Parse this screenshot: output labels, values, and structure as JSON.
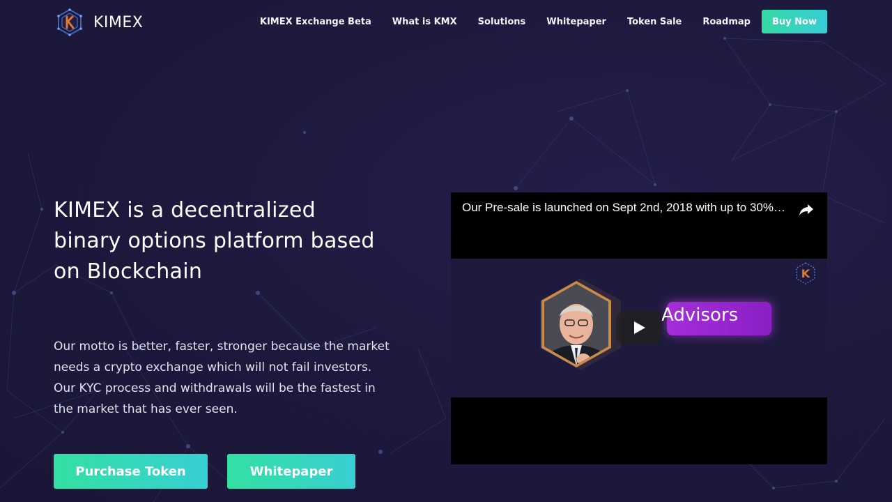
{
  "header": {
    "brand": "KIMEX",
    "nav": [
      {
        "label": "KIMEX Exchange Beta"
      },
      {
        "label": "What is KMX"
      },
      {
        "label": "Solutions"
      },
      {
        "label": "Whitepaper"
      },
      {
        "label": "Token Sale"
      },
      {
        "label": "Roadmap"
      }
    ],
    "buy_button": "Buy Now"
  },
  "hero": {
    "title_lines": [
      "KIMEX is a decentralized",
      "binary options platform based",
      "on Blockchain"
    ],
    "description_lines": [
      "Our motto is better, faster, stronger because the market",
      "needs a crypto exchange which will not fail investors.",
      "Our KYC process and withdrawals will be the fastest in",
      "the market that has ever seen."
    ],
    "purchase_button": "Purchase Token",
    "whitepaper_button": "Whitepaper"
  },
  "video": {
    "title": "Our Pre-sale is launched on Sept 2nd, 2018 with up to 30%…",
    "thumbnail_label": "Advisors",
    "thumbnail_logo_letter": "K"
  },
  "icons": {
    "logo": "kimex-hexagon-logo",
    "share": "share-arrow-icon",
    "play": "play-icon"
  },
  "colors": {
    "background": "#1e1a3e",
    "accent_green": "#33e0a2",
    "accent_teal": "#38cfd3",
    "advisors_purple": "#a42ed8",
    "logo_orange": "#e07a2e"
  }
}
